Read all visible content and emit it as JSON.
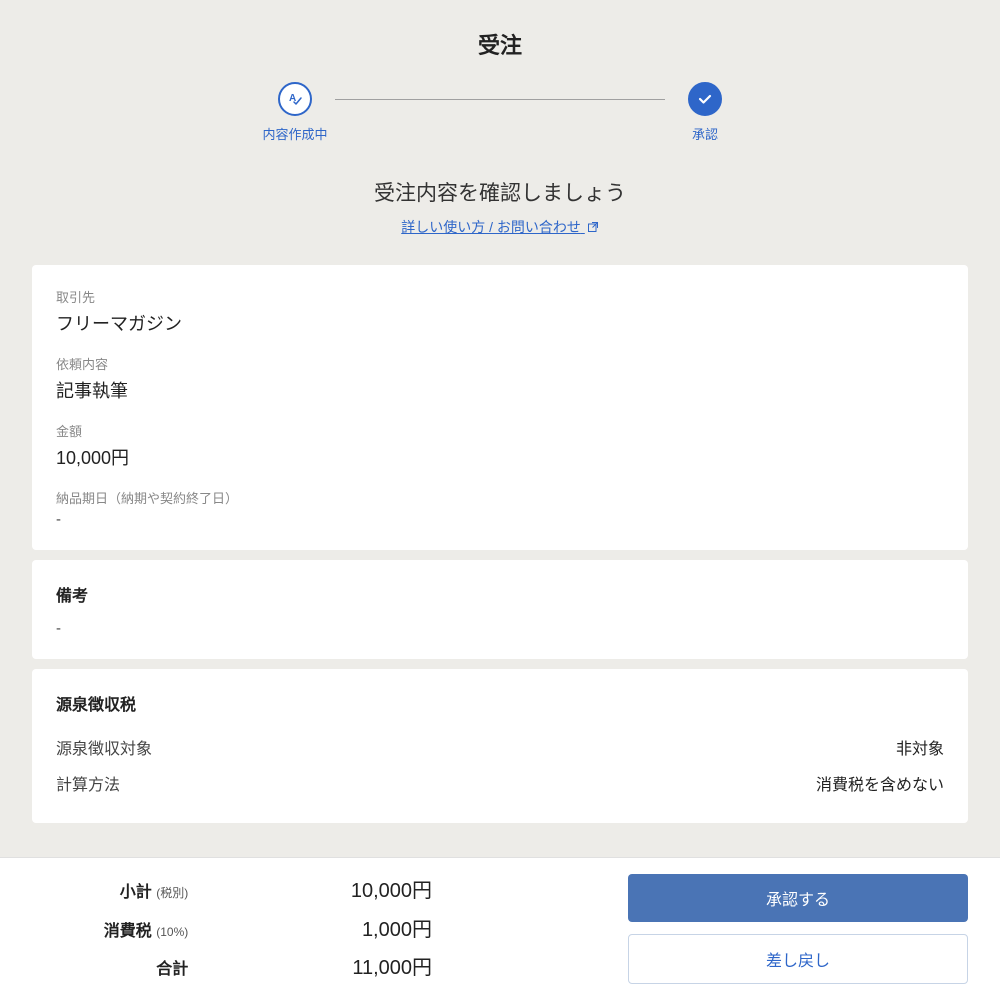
{
  "page_title": "受注",
  "steps": {
    "creating": "内容作成中",
    "approval": "承認"
  },
  "confirm_heading": "受注内容を確認しましょう",
  "help_link_text": "詳しい使い方 / お問い合わせ",
  "details": {
    "client_label": "取引先",
    "client_value": "フリーマガジン",
    "request_label": "依頼内容",
    "request_value": "記事執筆",
    "amount_label": "金額",
    "amount_value": "10,000円",
    "due_label": "納品期日（納期や契約終了日）",
    "due_value": "-"
  },
  "memo": {
    "title": "備考",
    "value": "-"
  },
  "withholding": {
    "title": "源泉徴収税",
    "target_label": "源泉徴収対象",
    "target_value": "非対象",
    "method_label": "計算方法",
    "method_value": "消費税を含めない"
  },
  "totals": {
    "subtotal_label": "小計",
    "subtotal_sub": "(税別)",
    "subtotal_value": "10,000円",
    "tax_label": "消費税",
    "tax_sub": "(10%)",
    "tax_value": "1,000円",
    "total_label": "合計",
    "total_value": "11,000円"
  },
  "actions": {
    "approve": "承認する",
    "reject": "差し戻し"
  }
}
